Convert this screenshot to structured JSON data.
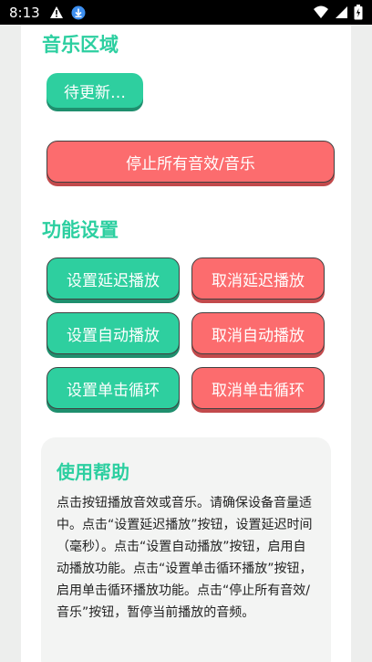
{
  "status_bar": {
    "time": "8:13",
    "icons": [
      "warning-icon",
      "download-icon",
      "wifi-icon",
      "signal-icon",
      "battery-icon"
    ]
  },
  "music": {
    "title": "音乐区域",
    "pending_button": "待更新…",
    "stop_all_button": "停止所有音效/音乐"
  },
  "settings": {
    "title": "功能设置",
    "set_delay": "设置延迟播放",
    "cancel_delay": "取消延迟播放",
    "set_auto": "设置自动播放",
    "cancel_auto": "取消自动播放",
    "set_loop": "设置单击循环",
    "cancel_loop": "取消单击循环"
  },
  "help": {
    "title": "使用帮助",
    "body": "点击按钮播放音效或音乐。请确保设备音量适中。点击“设置延迟播放”按钮，设置延迟时间（毫秒）。点击“设置自动播放”按钮，启用自动播放功能。点击“设置单击循环播放”按钮，启用单击循环播放功能。点击“停止所有音效/音乐”按钮，暂停当前播放的音频。"
  },
  "colors": {
    "accent_green": "#2ecf9f",
    "accent_red": "#fc6c6e",
    "title_green": "#2ccfa0"
  }
}
